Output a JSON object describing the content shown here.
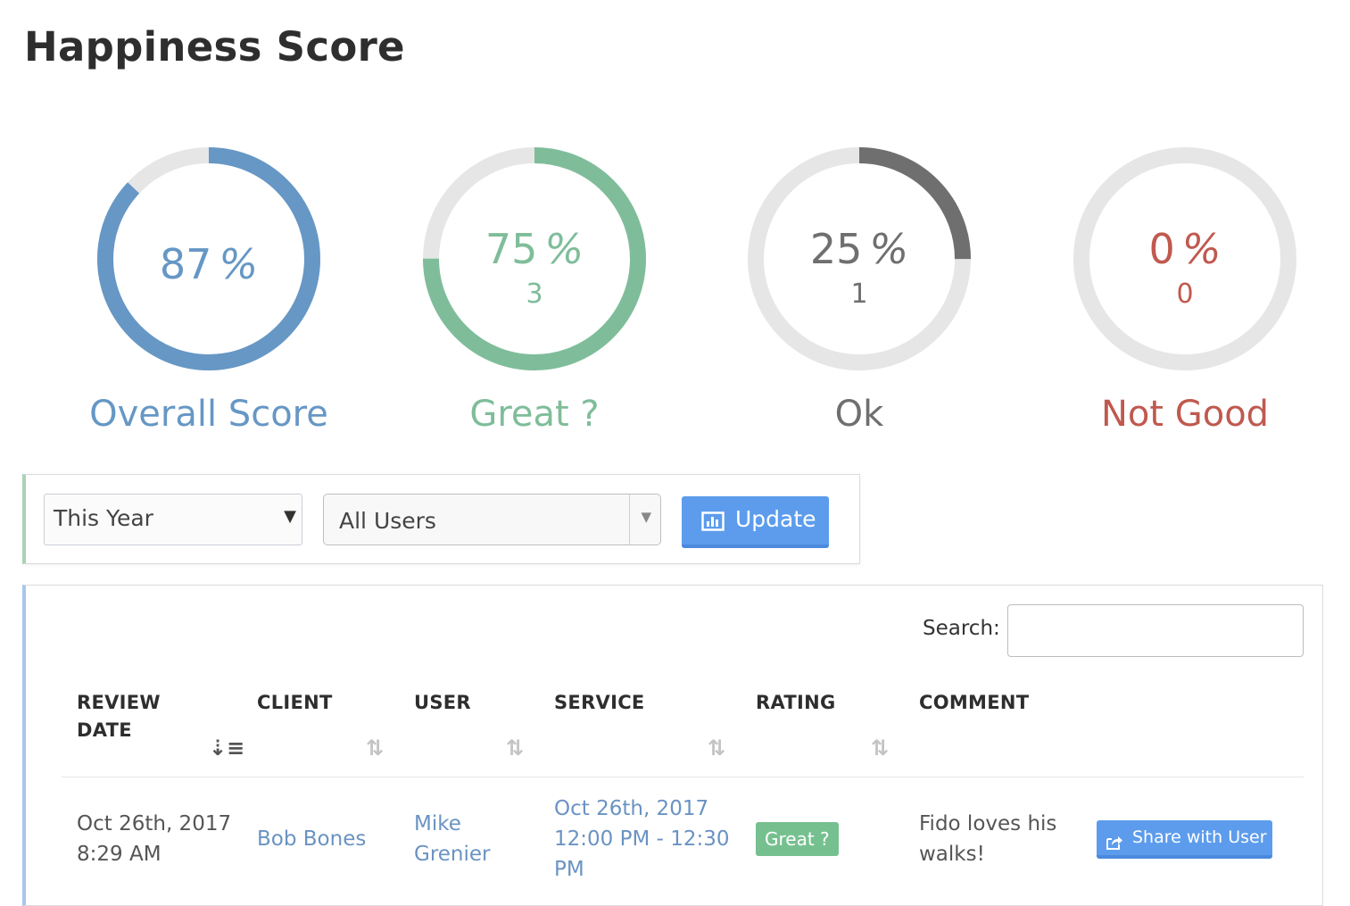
{
  "page": {
    "title": "Happiness Score"
  },
  "gauges": [
    {
      "key": "overall",
      "percent_text": "87",
      "percent_symbol": "%",
      "count": "",
      "label": "Overall Score",
      "fill_fraction": 0.87,
      "color": "#6697c5",
      "track_color": "#e6e6e6"
    },
    {
      "key": "great",
      "percent_text": "75",
      "percent_symbol": "%",
      "count": "3",
      "label": "Great ?",
      "fill_fraction": 0.75,
      "color": "#7fbd9a",
      "track_color": "#e6e6e6"
    },
    {
      "key": "ok",
      "percent_text": "25",
      "percent_symbol": "%",
      "count": "1",
      "label": "Ok",
      "fill_fraction": 0.25,
      "color": "#6f6f6f",
      "track_color": "#e6e6e6"
    },
    {
      "key": "notgood",
      "percent_text": "0",
      "percent_symbol": "%",
      "count": "0",
      "label": "Not Good",
      "fill_fraction": 0.0,
      "color": "#c0594e",
      "track_color": "#e6e6e6"
    }
  ],
  "filters": {
    "period": {
      "value": "This Year"
    },
    "users": {
      "value": "All Users"
    },
    "update_label": "Update",
    "update_icon": "bar-chart-icon"
  },
  "table": {
    "search_label": "Search:",
    "search_value": "",
    "columns": [
      {
        "line1": "REVIEW",
        "line2": "DATE"
      },
      {
        "line1": "CLIENT",
        "line2": ""
      },
      {
        "line1": "USER",
        "line2": ""
      },
      {
        "line1": "SERVICE",
        "line2": ""
      },
      {
        "line1": "RATING",
        "line2": ""
      },
      {
        "line1": "COMMENT",
        "line2": ""
      }
    ],
    "rows": [
      {
        "review_date": [
          "Oct 26th, 2017",
          "8:29 AM"
        ],
        "client": "Bob Bones",
        "user": [
          "Mike",
          "Grenier"
        ],
        "service": [
          "Oct 26th, 2017",
          "12:00 PM - 12:30",
          "PM"
        ],
        "rating": "Great ?",
        "comment": [
          "Fido loves his",
          "walks!"
        ],
        "action_label": "Share with User",
        "action_icon": "share-icon"
      }
    ]
  },
  "colors": {
    "accent": "#5d9cec",
    "great": "#7fbd9a",
    "overall": "#6697c5",
    "not_good": "#c0594e"
  }
}
